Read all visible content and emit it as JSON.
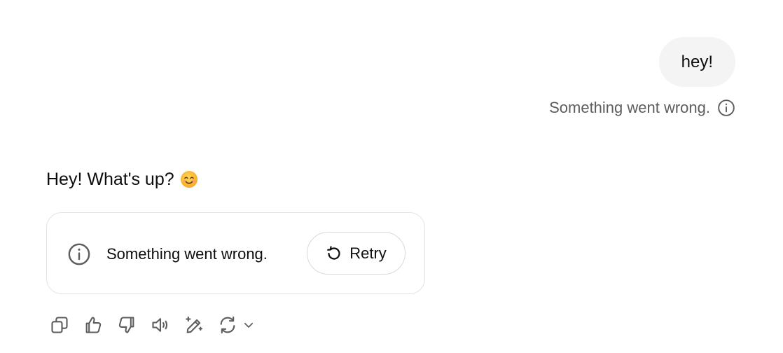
{
  "user_message": {
    "text": "hey!",
    "error_text": "Something went wrong.",
    "error_icon": "info-icon"
  },
  "assistant_message": {
    "text": "Hey! What's up?",
    "emoji": "smiling-face-emoji"
  },
  "error_card": {
    "message": "Something went wrong.",
    "icon": "info-icon",
    "retry_label": "Retry",
    "retry_icon": "retry-icon"
  },
  "action_bar": {
    "icons": [
      "copy-icon",
      "thumbs-up-icon",
      "thumbs-down-icon",
      "read-aloud-icon",
      "edit-sparkle-icon",
      "regenerate-icon",
      "chevron-down-icon"
    ]
  },
  "colors": {
    "bubble_bg": "#f4f4f4",
    "muted_text": "#5d5d5d",
    "card_border": "#e3e3e3",
    "icon_stroke": "#5d5d5d"
  }
}
